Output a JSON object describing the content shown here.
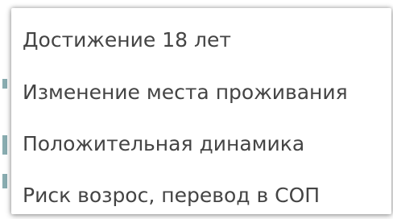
{
  "dropdown": {
    "options": [
      {
        "label": "Достижение 18 лет"
      },
      {
        "label": "Изменение места проживания"
      },
      {
        "label": "Положительная динамика"
      },
      {
        "label": "Риск возрос, перевод в СОП"
      }
    ]
  }
}
